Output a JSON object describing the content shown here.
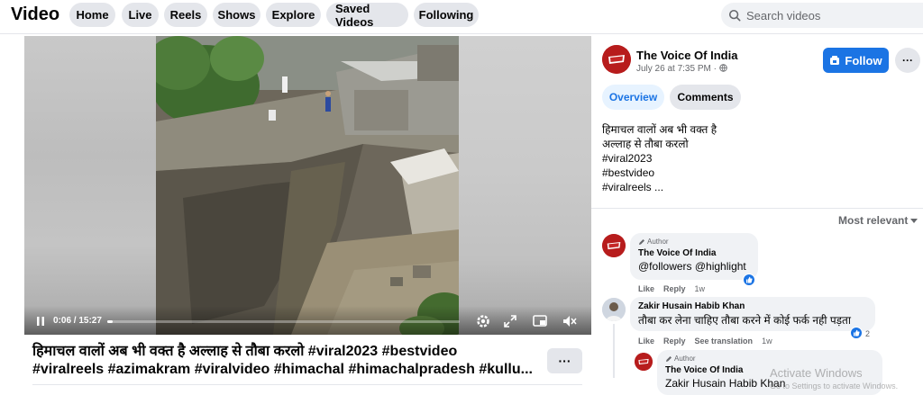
{
  "header": {
    "title": "Video",
    "nav": [
      "Home",
      "Live",
      "Reels",
      "Shows",
      "Explore",
      "Saved Videos",
      "Following"
    ],
    "search_placeholder": "Search videos"
  },
  "player": {
    "time": "0:06 / 15:27",
    "progress": 0.0065
  },
  "video_title": "हिमाचल वालों अब भी वक्त है अल्लाह से तौबा करलो #viral2023 #bestvideo #viralreels #azimakram #viralvideo #himachal #himachalpradesh #kullu...",
  "video_title_line1": "हिमाचल वालों अब भी वक्त है अल्लाह से तौबा करलो #viral2023 #bestvideo",
  "video_title_line2": "#viralreels #azimakram #viralvideo #himachal #himachalpradesh #kullu...",
  "more_label": "···",
  "post": {
    "page_name": "The Voice Of India",
    "meta": "July 26 at 7:35 PM · ",
    "follow_label": "Follow",
    "dots_label": "···",
    "tabs": [
      "Overview",
      "Comments"
    ],
    "description": [
      "हिमाचल वालों अब भी वक्त है",
      "अल्लाह से तौबा करलो",
      "#viral2023",
      "#bestvideo",
      "#viralreels ..."
    ],
    "sort_label": "Most relevant"
  },
  "comments": [
    {
      "author_tag": "Author",
      "name": "The Voice Of India",
      "text": "@followers @highlight",
      "actions": [
        "Like",
        "Reply"
      ],
      "time": "1w"
    },
    {
      "name": "Zakir Husain Habib Khan",
      "text": "तौबा कर लेना चाहिए तौबा करने में कोई फर्क नही पड़ता",
      "actions": [
        "Like",
        "Reply",
        "See translation"
      ],
      "time": "1w",
      "likes": "2"
    },
    {
      "author_tag": "Author",
      "name": "The Voice Of India",
      "text": "Zakir Husain Habib Khan"
    }
  ],
  "watermark": {
    "line1": "Activate Windows",
    "line2": "Go to Settings to activate Windows."
  },
  "colors": {
    "accent": "#1b74e4",
    "pill_bg": "#e4e6eb",
    "page_avatar": "#b71c1c"
  }
}
